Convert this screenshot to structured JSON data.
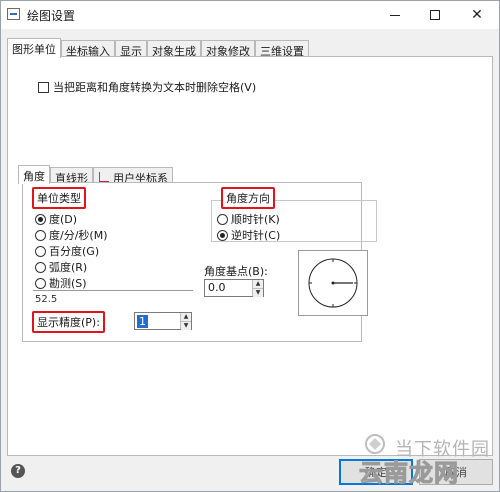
{
  "window": {
    "title": "绘图设置",
    "controls": {
      "minimize": "minimize-icon",
      "maximize": "maximize-icon",
      "close": "close-icon"
    }
  },
  "tabs": [
    {
      "label": "图形单位",
      "active": true
    },
    {
      "label": "坐标输入",
      "active": false
    },
    {
      "label": "显示",
      "active": false
    },
    {
      "label": "对象生成",
      "active": false
    },
    {
      "label": "对象修改",
      "active": false
    },
    {
      "label": "三维设置",
      "active": false
    }
  ],
  "options": {
    "remove_spaces_label": "当把距离和角度转换为文本时删除空格(V)",
    "remove_spaces_checked": false
  },
  "inner_tabs": [
    {
      "label": "角度",
      "active": true
    },
    {
      "label": "直线形",
      "active": false
    },
    {
      "label": "用户坐标系",
      "active": false
    }
  ],
  "unit_type": {
    "label": "单位类型",
    "options": [
      {
        "label": "度(D)",
        "selected": true
      },
      {
        "label": "度/分/秒(M)",
        "selected": false
      },
      {
        "label": "百分度(G)",
        "selected": false
      },
      {
        "label": "弧度(R)",
        "selected": false
      },
      {
        "label": "勘测(S)",
        "selected": false
      }
    ],
    "preview": "52.5"
  },
  "precision": {
    "label": "显示精度(P):",
    "value": "1"
  },
  "direction": {
    "label": "角度方向",
    "options": [
      {
        "label": "顺时针(K)",
        "selected": false
      },
      {
        "label": "逆时针(C)",
        "selected": true
      }
    ]
  },
  "base_angle": {
    "label": "角度基点(B):",
    "value": "0.0"
  },
  "buttons": {
    "help": "?",
    "ok": "确定",
    "cancel": "取消"
  },
  "watermark": {
    "top": "当下软件园",
    "main": "云南龙网"
  },
  "colors": {
    "highlight_border": "#e0141e",
    "selection": "#1f6fd1"
  }
}
